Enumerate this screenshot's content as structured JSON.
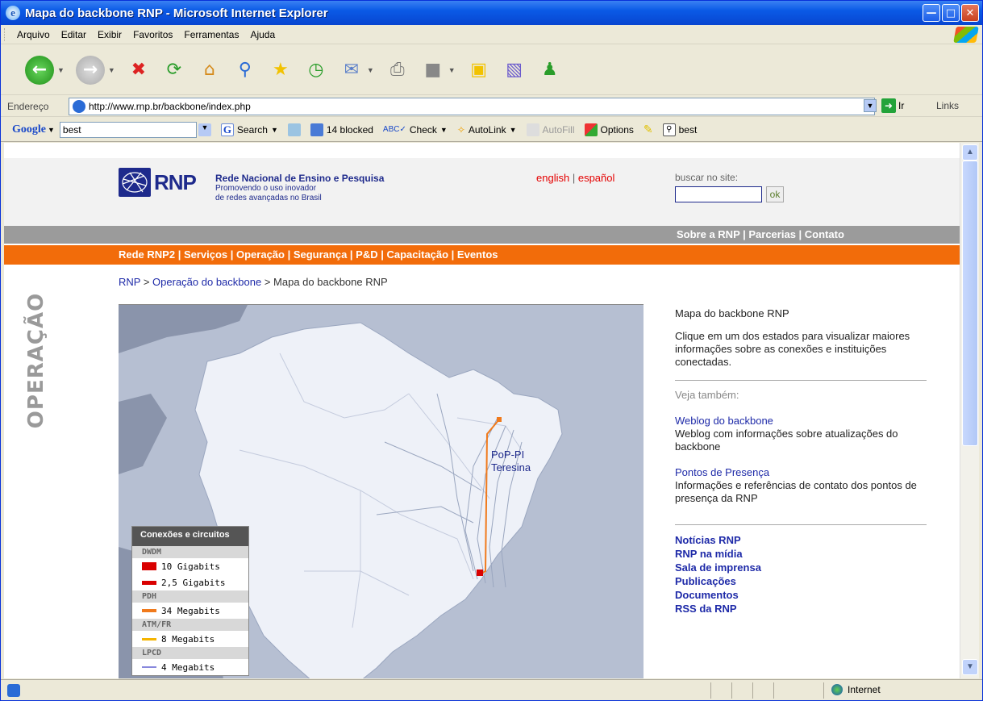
{
  "window": {
    "title": "Mapa do backbone RNP - Microsoft Internet Explorer"
  },
  "menu": [
    "Arquivo",
    "Editar",
    "Exibir",
    "Favoritos",
    "Ferramentas",
    "Ajuda"
  ],
  "address": {
    "label": "Endereço",
    "url": "http://www.rnp.br/backbone/index.php",
    "go_label": "Ir",
    "links_label": "Links"
  },
  "google_bar": {
    "brand": "Google",
    "query": "best",
    "search_label": "Search",
    "blocked_label": "14 blocked",
    "check_label": "Check",
    "autolink_label": "AutoLink",
    "autofill_label": "AutoFill",
    "options_label": "Options",
    "highlight_label": "best"
  },
  "status": {
    "zone": "Internet"
  },
  "site": {
    "logo_text": "RNP",
    "org_name": "Rede Nacional de Ensino e Pesquisa",
    "tagline_1": "Promovendo o uso inovador",
    "tagline_2": "de redes avançadas no Brasil",
    "lang_en": "english",
    "lang_sep": "|",
    "lang_es": "español",
    "search_label": "buscar no site:",
    "search_value": "",
    "search_button": "ok",
    "top_links": "Sobre a RNP | Parcerias | Contato",
    "main_nav": "Rede RNP2 | Serviços | Operação | Segurança | P&D | Capacitação | Eventos",
    "breadcrumb": {
      "home": "RNP",
      "sep": " > ",
      "section": "Operação do backbone",
      "current": "Mapa do backbone RNP"
    },
    "section_label": "OPERAÇÃO"
  },
  "map": {
    "pop_label": "PoP-PI",
    "pop_city": "Teresina",
    "legend": {
      "title": "Conexões e circuitos",
      "groups": [
        {
          "name": "DWDM",
          "rows": [
            "10 Gigabits",
            "2,5 Gigabits"
          ]
        },
        {
          "name": "PDH",
          "rows": [
            "34 Megabits"
          ]
        },
        {
          "name": "ATM/FR",
          "rows": [
            "8 Megabits"
          ]
        },
        {
          "name": "LPCD",
          "rows": [
            "4 Megabits"
          ]
        }
      ]
    },
    "colors": {
      "dwdm": "#d90000",
      "pdh": "#f07a1c",
      "atm": "#f5b400",
      "lpcd": "#8888dd"
    }
  },
  "sidebar": {
    "title": "Mapa do backbone RNP",
    "desc": "Clique em um dos estados para visualizar maiores informações sobre as conexões e instituições conectadas.",
    "see_also": "Veja também:",
    "weblog_link": "Weblog do backbone",
    "weblog_desc": "Weblog com informações sobre atualizações do backbone",
    "pops_link": "Pontos de Presença",
    "pops_desc": "Informações e referências de contato dos pontos de presença da RNP",
    "links": [
      "Notícias RNP",
      "RNP na mídia",
      "Sala de imprensa",
      "Publicações",
      "Documentos",
      "RSS da RNP"
    ]
  }
}
